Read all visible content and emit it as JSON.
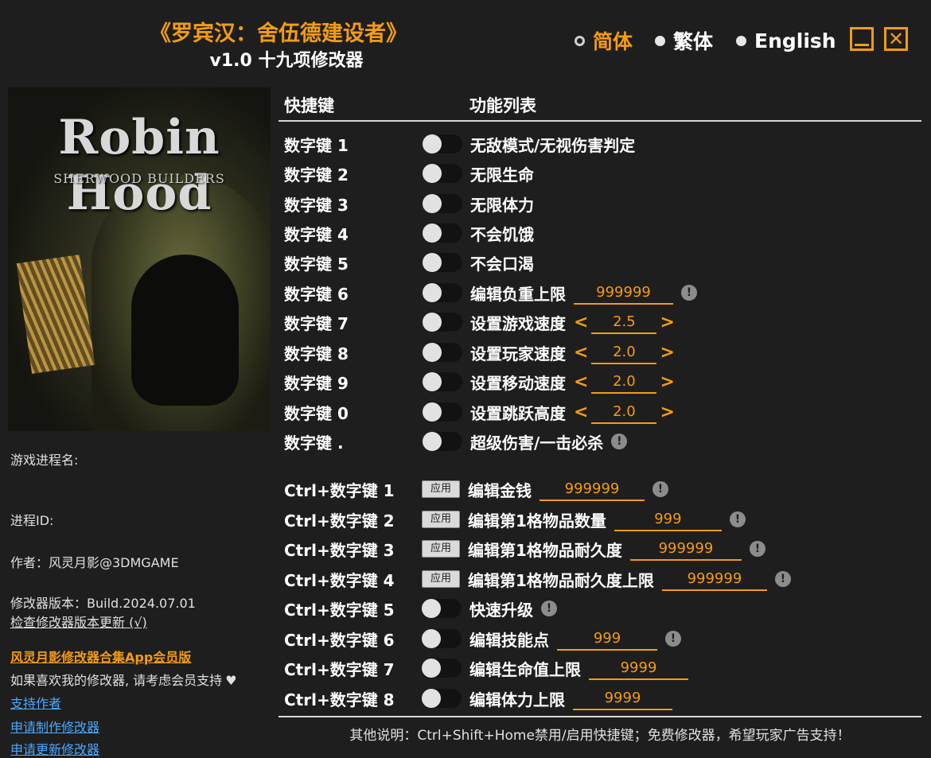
{
  "header": {
    "title": "《罗宾汉：舍伍德建设者》",
    "subtitle": "v1.0 十九项修改器"
  },
  "languages": [
    {
      "label": "简体",
      "active": true
    },
    {
      "label": "繁体",
      "active": false
    },
    {
      "label": "English",
      "active": false
    }
  ],
  "window_controls": {
    "minimize_icon": "minimize-icon",
    "close_icon": "close-icon",
    "close_glyph": "✕"
  },
  "cover": {
    "logo_line1": "Robin Hood",
    "logo_line2": "SHERWOOD BUILDERS"
  },
  "info": {
    "process_name_label": "游戏进程名:",
    "process_id_label": "进程ID:",
    "author": "作者：风灵月影@3DMGAME",
    "version": "修改器版本：Build.2024.07.01",
    "check_update": "检查修改器版本更新 (√)",
    "app_link": "风灵月影修改器合集App会员版",
    "support_text": "如果喜欢我的修改器, 请考虑会员支持",
    "support_heart": "♥",
    "link_support": "支持作者",
    "link_request": "申请制作修改器",
    "link_update": "申请更新修改器"
  },
  "table": {
    "col_hotkey": "快捷键",
    "col_features": "功能列表",
    "rows": [
      {
        "key": "数字键 1",
        "control": "toggle",
        "feature": "无敌模式/无视伤害判定"
      },
      {
        "key": "数字键 2",
        "control": "toggle",
        "feature": "无限生命"
      },
      {
        "key": "数字键 3",
        "control": "toggle",
        "feature": "无限体力"
      },
      {
        "key": "数字键 4",
        "control": "toggle",
        "feature": "不会饥饿"
      },
      {
        "key": "数字键 5",
        "control": "toggle",
        "feature": "不会口渴"
      },
      {
        "key": "数字键 6",
        "control": "toggle",
        "feature": "编辑负重上限",
        "value": "999999",
        "warn": true
      },
      {
        "key": "数字键 7",
        "control": "toggle",
        "feature": "设置游戏速度",
        "stepper": true,
        "value": "2.5"
      },
      {
        "key": "数字键 8",
        "control": "toggle",
        "feature": "设置玩家速度",
        "stepper": true,
        "value": "2.0"
      },
      {
        "key": "数字键 9",
        "control": "toggle",
        "feature": "设置移动速度",
        "stepper": true,
        "value": "2.0"
      },
      {
        "key": "数字键 0",
        "control": "toggle",
        "feature": "设置跳跃高度",
        "stepper": true,
        "value": "2.0"
      },
      {
        "key": "数字键 .",
        "control": "toggle",
        "feature": "超级伤害/一击必杀",
        "warn": true
      },
      {
        "key": "Ctrl+数字键 1",
        "control": "apply",
        "feature": "编辑金钱",
        "value": "999999",
        "warn": true
      },
      {
        "key": "Ctrl+数字键 2",
        "control": "apply",
        "feature": "编辑第1格物品数量",
        "value": "999",
        "warn": true
      },
      {
        "key": "Ctrl+数字键 3",
        "control": "apply",
        "feature": "编辑第1格物品耐久度",
        "value": "999999",
        "warn": true
      },
      {
        "key": "Ctrl+数字键 4",
        "control": "apply",
        "feature": "编辑第1格物品耐久度上限",
        "value": "999999",
        "warn": true
      },
      {
        "key": "Ctrl+数字键 5",
        "control": "toggle",
        "feature": "快速升级",
        "warn": true
      },
      {
        "key": "Ctrl+数字键 6",
        "control": "toggle",
        "feature": "编辑技能点",
        "value": "999",
        "warn": true
      },
      {
        "key": "Ctrl+数字键 7",
        "control": "toggle",
        "feature": "编辑生命值上限",
        "value": "9999"
      },
      {
        "key": "Ctrl+数字键 8",
        "control": "toggle",
        "feature": "编辑体力上限",
        "value": "9999"
      }
    ],
    "apply_label": "应用",
    "warn_glyph": "!",
    "left_arrow": "<",
    "right_arrow": ">"
  },
  "footer": "其他说明：Ctrl+Shift+Home禁用/启用快捷键；免费修改器，希望玩家广告支持！",
  "colors": {
    "accent": "#f39c12",
    "background": "#1e1e1e",
    "link": "#4aa8ff"
  }
}
